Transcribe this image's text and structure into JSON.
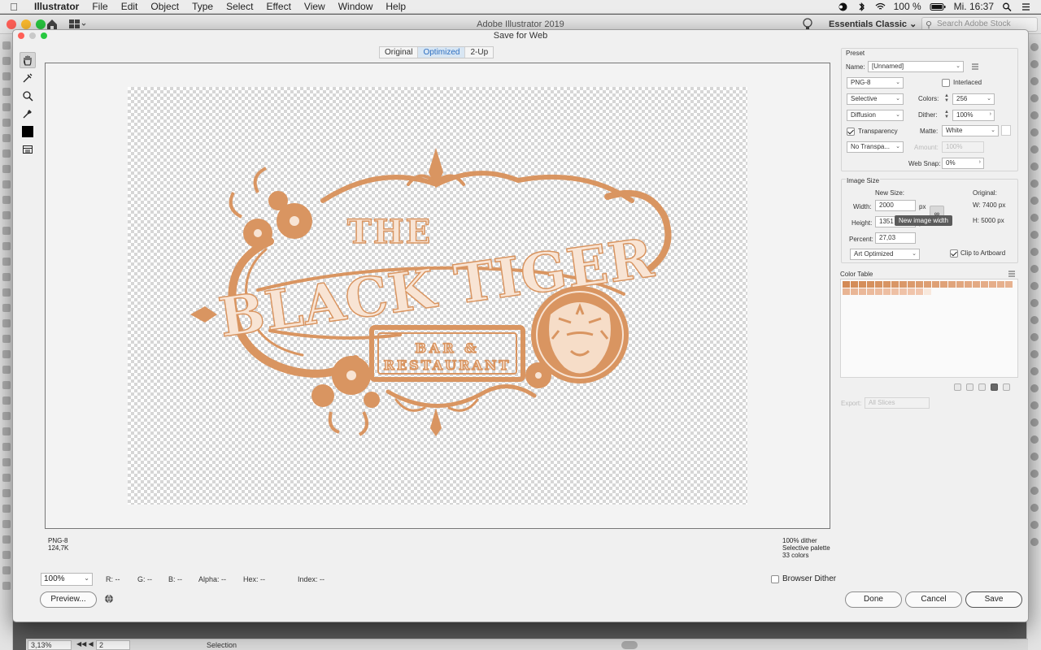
{
  "menubar": {
    "app": "Illustrator",
    "items": [
      "File",
      "Edit",
      "Object",
      "Type",
      "Select",
      "Effect",
      "View",
      "Window",
      "Help"
    ],
    "battery": "100 %",
    "clock": "Mi. 16:37"
  },
  "appbar": {
    "title": "Adobe Illustrator 2019",
    "workspace": "Essentials Classic",
    "search_placeholder": "Search Adobe Stock"
  },
  "dialog": {
    "title": "Save for Web",
    "tabs": [
      "Original",
      "Optimized",
      "2-Up"
    ],
    "active_tab": "Optimized",
    "artwork": {
      "title_small": "THE",
      "title_main": "BLACK TIGER",
      "banner_line1": "BAR &",
      "banner_line2": "RESTAURANT",
      "accent_color": "#d99561",
      "cream_color": "#f8e4d4"
    },
    "info_left": [
      "PNG-8",
      "124,7K"
    ],
    "info_right": [
      "100% dither",
      "Selective palette",
      "33 colors"
    ],
    "zoom": "100%",
    "readouts": {
      "r": "R: --",
      "g": "G: --",
      "b": "B: --",
      "alpha": "Alpha: --",
      "hex": "Hex: --",
      "index": "Index: --"
    },
    "browser_dither_label": "Browser Dither",
    "browser_dither_checked": false,
    "preview_label": "Preview...",
    "done_label": "Done",
    "cancel_label": "Cancel",
    "save_label": "Save"
  },
  "preset": {
    "header": "Preset",
    "name_label": "Name:",
    "name_value": "[Unnamed]",
    "format": "PNG-8",
    "interlaced_label": "Interlaced",
    "interlaced": false,
    "reduction": "Selective",
    "colors_label": "Colors:",
    "colors_value": "256",
    "dither_algo": "Diffusion",
    "dither_label": "Dither:",
    "dither_value": "100%",
    "transparency_label": "Transparency",
    "transparency": true,
    "matte_label": "Matte:",
    "matte_value": "White",
    "transparency_dither": "No Transpa...",
    "amount_label": "Amount:",
    "amount_value": "100%",
    "websnap_label": "Web Snap:",
    "websnap_value": "0%"
  },
  "image_size": {
    "header": "Image Size",
    "new_size_label": "New Size:",
    "original_label": "Original:",
    "width_label": "Width:",
    "width_value": "2000",
    "height_label": "Height:",
    "height_value": "1351",
    "unit": "px",
    "orig_w": "W:  7400 px",
    "orig_h": "H:  5000 px",
    "percent_label": "Percent:",
    "percent_value": "27,03",
    "quality": "Art Optimized",
    "clip_label": "Clip to Artboard",
    "clip": true,
    "tooltip": "New image width"
  },
  "color_table": {
    "header": "Color Table",
    "swatches": [
      "#d48a55",
      "#d48c58",
      "#d58e5a",
      "#d6905d",
      "#d79260",
      "#d89463",
      "#d99666",
      "#da9869",
      "#db9a6c",
      "#dc9c6f",
      "#dd9e72",
      "#dea075",
      "#dfa278",
      "#e0a47b",
      "#e1a67e",
      "#e2a881",
      "#e3aa84",
      "#e4ac87",
      "#e5ae8a",
      "#e6b08d",
      "#e7b290",
      "#e8b493",
      "#e9b696",
      "#eab899",
      "#ebba9c",
      "#ecbc9f",
      "#edbea2",
      "#eec0a5",
      "#efc2a8",
      "#f0c4ab",
      "#f1c6ae",
      "#f8e8dc"
    ],
    "export_label": "Export:",
    "export_value": "All Slices"
  },
  "statusbar": {
    "zoom": "3,13%",
    "page": "2",
    "tool": "Selection"
  }
}
